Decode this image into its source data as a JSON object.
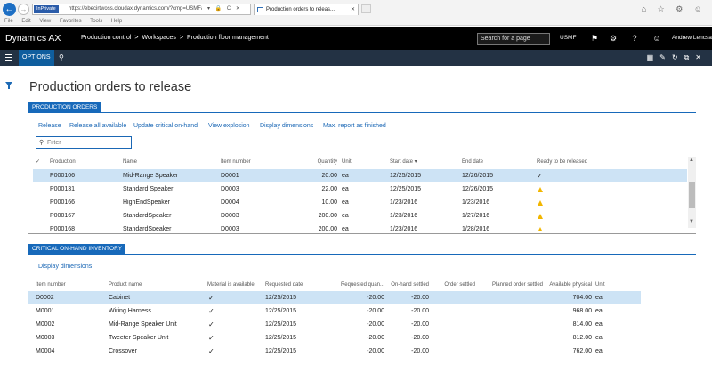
{
  "browser": {
    "inprivate_label": "InPrivate",
    "url": "https://ebecirtwoss.cloudax.dynamics.com/?cmp=USMF&mi=Jr",
    "addr_icons": "▾ 🔒 C ✕",
    "tab_title": "Production orders to releas...",
    "tab_close": "✕",
    "window_icons": "⌂ ☆ ⚙ ☺",
    "menu": [
      "File",
      "Edit",
      "View",
      "Favorites",
      "Tools",
      "Help"
    ]
  },
  "topbar": {
    "app_name": "Dynamics AX",
    "breadcrumb": [
      "Production control",
      "Workspaces",
      "Production floor management"
    ],
    "search_placeholder": "Search for a page",
    "company": "USMF",
    "user": "Andrew Lencsak"
  },
  "actionpane": {
    "options_label": "OPTIONS"
  },
  "page": {
    "title": "Production orders to release"
  },
  "production_orders": {
    "tab_label": "PRODUCTION ORDERS",
    "actions": [
      "Release",
      "Release all available",
      "Update critical on-hand",
      "View explosion",
      "Display dimensions",
      "Max. report as finished"
    ],
    "filter_placeholder": "Filter",
    "columns": [
      "Production",
      "Name",
      "Item number",
      "Quantity",
      "Unit",
      "Start date ▾",
      "End date",
      "Ready to be released"
    ],
    "rows": [
      {
        "production": "P000106",
        "name": "Mid-Range Speaker",
        "item": "D0001",
        "qty": "20.00",
        "unit": "ea",
        "start": "12/25/2015",
        "end": "12/26/2015",
        "ready": "check"
      },
      {
        "production": "P000131",
        "name": "Standard Speaker",
        "item": "D0003",
        "qty": "22.00",
        "unit": "ea",
        "start": "12/25/2015",
        "end": "12/26/2015",
        "ready": "warn"
      },
      {
        "production": "P000166",
        "name": "HighEndSpeaker",
        "item": "D0004",
        "qty": "10.00",
        "unit": "ea",
        "start": "1/23/2016",
        "end": "1/23/2016",
        "ready": "warn"
      },
      {
        "production": "P000167",
        "name": "StandardSpeaker",
        "item": "D0003",
        "qty": "200.00",
        "unit": "ea",
        "start": "1/23/2016",
        "end": "1/27/2016",
        "ready": "warn"
      },
      {
        "production": "P000168",
        "name": "StandardSpeaker",
        "item": "D0003",
        "qty": "200.00",
        "unit": "ea",
        "start": "1/23/2016",
        "end": "1/28/2016",
        "ready": "warn"
      }
    ]
  },
  "critical_inventory": {
    "tab_label": "CRITICAL ON-HAND INVENTORY",
    "action": "Display dimensions",
    "columns": [
      "Item number",
      "Product name",
      "Material is available",
      "Requested date",
      "Requested quan...",
      "On-hand settled",
      "Order settled",
      "Planned order settled",
      "Available physical",
      "Unit"
    ],
    "rows": [
      {
        "item": "D0002",
        "product": "Cabinet",
        "available": "✓",
        "date": "12/25/2015",
        "req": "-20.00",
        "onhand": "-20.00",
        "phys": "704.00",
        "unit": "ea"
      },
      {
        "item": "M0001",
        "product": "Wiring Harness",
        "available": "✓",
        "date": "12/25/2015",
        "req": "-20.00",
        "onhand": "-20.00",
        "phys": "968.00",
        "unit": "ea"
      },
      {
        "item": "M0002",
        "product": "Mid-Range Speaker Unit",
        "available": "✓",
        "date": "12/25/2015",
        "req": "-20.00",
        "onhand": "-20.00",
        "phys": "814.00",
        "unit": "ea"
      },
      {
        "item": "M0003",
        "product": "Tweeter Speaker Unit",
        "available": "✓",
        "date": "12/25/2015",
        "req": "-20.00",
        "onhand": "-20.00",
        "phys": "812.00",
        "unit": "ea"
      },
      {
        "item": "M0004",
        "product": "Crossover",
        "available": "✓",
        "date": "12/25/2015",
        "req": "-20.00",
        "onhand": "-20.00",
        "phys": "762.00",
        "unit": "ea"
      }
    ]
  },
  "colors": {
    "accent": "#1769ba",
    "selected_row": "#cde3f5",
    "warning": "#f2b600",
    "nav_dark": "#233244"
  }
}
